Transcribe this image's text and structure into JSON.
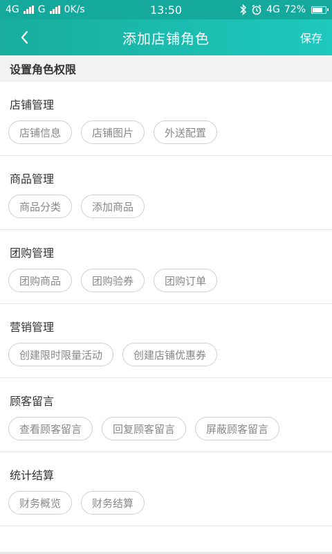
{
  "status_bar": {
    "network1": "4G",
    "network2": "G",
    "speed": "0K/s",
    "time": "13:50",
    "network3": "4G",
    "battery": "72%",
    "battery_level": 0.72
  },
  "app_bar": {
    "title": "添加店铺角色",
    "save_label": "保存",
    "back_icon": "chevron-left-icon"
  },
  "section": {
    "title": "设置角色权限"
  },
  "groups": [
    {
      "title": "店铺管理",
      "chips": [
        "店铺信息",
        "店铺图片",
        "外送配置"
      ]
    },
    {
      "title": "商品管理",
      "chips": [
        "商品分类",
        "添加商品"
      ]
    },
    {
      "title": "团购管理",
      "chips": [
        "团购商品",
        "团购验券",
        "团购订单"
      ]
    },
    {
      "title": "营销管理",
      "chips": [
        "创建限时限量活动",
        "创建店铺优惠券"
      ]
    },
    {
      "title": "顾客留言",
      "chips": [
        "查看顾客留言",
        "回复顾客留言",
        "屏蔽顾客留言"
      ]
    },
    {
      "title": "统计结算",
      "chips": [
        "财务概览",
        "财务结算"
      ]
    }
  ],
  "colors": {
    "header_start": "#18ad9d",
    "header_end": "#1ec9be",
    "chip_border": "#cfcfcf",
    "chip_text": "#888888"
  }
}
